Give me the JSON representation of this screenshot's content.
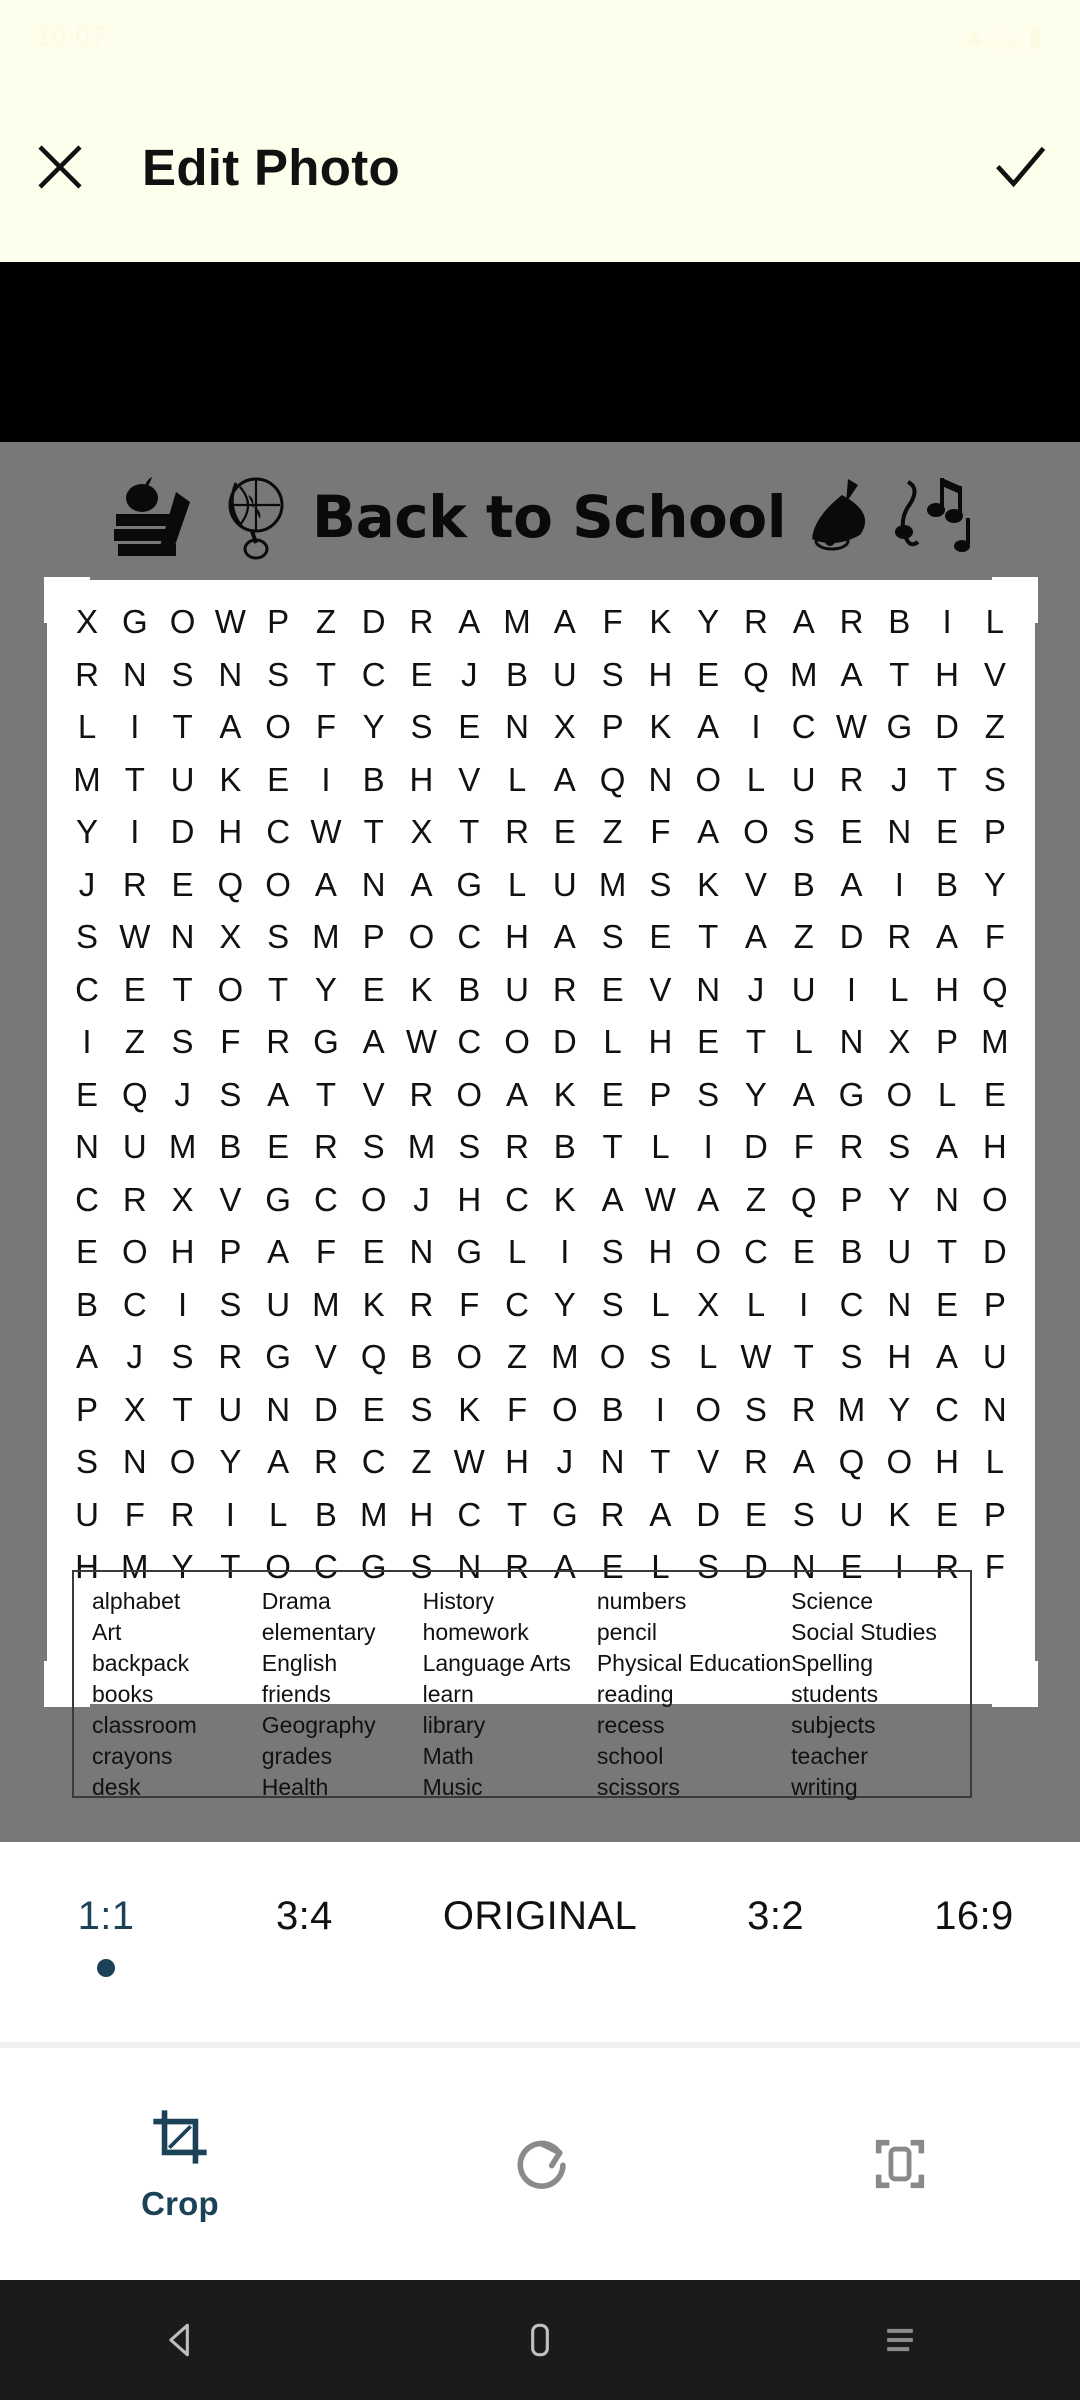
{
  "statusbar": {
    "time": "10:07",
    "icons": [
      "signal-icon",
      "wifi-icon",
      "battery-icon"
    ]
  },
  "header": {
    "title": "Edit Photo",
    "close_icon": "close-icon",
    "confirm_icon": "check-icon"
  },
  "photo": {
    "puzzle_title": "Back to School",
    "clipart": [
      "apple-books-pencil-icon",
      "globe-icon",
      "bell-icon",
      "music-notes-icon"
    ],
    "grid": {
      "rows": 19,
      "cols": 20,
      "letters": [
        [
          "X",
          "G",
          "O",
          "W",
          "P",
          "Z",
          "D",
          "R",
          "A",
          "M",
          "A",
          "F",
          "K",
          "Y",
          "R",
          "A",
          "R",
          "B",
          "I",
          "L"
        ],
        [
          "R",
          "N",
          "S",
          "N",
          "S",
          "T",
          "C",
          "E",
          "J",
          "B",
          "U",
          "S",
          "H",
          "E",
          "Q",
          "M",
          "A",
          "T",
          "H",
          "V"
        ],
        [
          "L",
          "I",
          "T",
          "A",
          "O",
          "F",
          "Y",
          "S",
          "E",
          "N",
          "X",
          "P",
          "K",
          "A",
          "I",
          "C",
          "W",
          "G",
          "D",
          "Z"
        ],
        [
          "M",
          "T",
          "U",
          "K",
          "E",
          "I",
          "B",
          "H",
          "V",
          "L",
          "A",
          "Q",
          "N",
          "O",
          "L",
          "U",
          "R",
          "J",
          "T",
          "S"
        ],
        [
          "Y",
          "I",
          "D",
          "H",
          "C",
          "W",
          "T",
          "X",
          "T",
          "R",
          "E",
          "Z",
          "F",
          "A",
          "O",
          "S",
          "E",
          "N",
          "E",
          "P"
        ],
        [
          "J",
          "R",
          "E",
          "Q",
          "O",
          "A",
          "N",
          "A",
          "G",
          "L",
          "U",
          "M",
          "S",
          "K",
          "V",
          "B",
          "A",
          "I",
          "B",
          "Y"
        ],
        [
          "S",
          "W",
          "N",
          "X",
          "S",
          "M",
          "P",
          "O",
          "C",
          "H",
          "A",
          "S",
          "E",
          "T",
          "A",
          "Z",
          "D",
          "R",
          "A",
          "F"
        ],
        [
          "C",
          "E",
          "T",
          "O",
          "T",
          "Y",
          "E",
          "K",
          "B",
          "U",
          "R",
          "E",
          "V",
          "N",
          "J",
          "U",
          "I",
          "L",
          "H",
          "Q"
        ],
        [
          "I",
          "Z",
          "S",
          "F",
          "R",
          "G",
          "A",
          "W",
          "C",
          "O",
          "D",
          "L",
          "H",
          "E",
          "T",
          "L",
          "N",
          "X",
          "P",
          "M"
        ],
        [
          "E",
          "Q",
          "J",
          "S",
          "A",
          "T",
          "V",
          "R",
          "O",
          "A",
          "K",
          "E",
          "P",
          "S",
          "Y",
          "A",
          "G",
          "O",
          "L",
          "E"
        ],
        [
          "N",
          "U",
          "M",
          "B",
          "E",
          "R",
          "S",
          "M",
          "S",
          "R",
          "B",
          "T",
          "L",
          "I",
          "D",
          "F",
          "R",
          "S",
          "A",
          "H"
        ],
        [
          "C",
          "R",
          "X",
          "V",
          "G",
          "C",
          "O",
          "J",
          "H",
          "C",
          "K",
          "A",
          "W",
          "A",
          "Z",
          "Q",
          "P",
          "Y",
          "N",
          "O"
        ],
        [
          "E",
          "O",
          "H",
          "P",
          "A",
          "F",
          "E",
          "N",
          "G",
          "L",
          "I",
          "S",
          "H",
          "O",
          "C",
          "E",
          "B",
          "U",
          "T",
          "D"
        ],
        [
          "B",
          "C",
          "I",
          "S",
          "U",
          "M",
          "K",
          "R",
          "F",
          "C",
          "Y",
          "S",
          "L",
          "X",
          "L",
          "I",
          "C",
          "N",
          "E",
          "P"
        ],
        [
          "A",
          "J",
          "S",
          "R",
          "G",
          "V",
          "Q",
          "B",
          "O",
          "Z",
          "M",
          "O",
          "S",
          "L",
          "W",
          "T",
          "S",
          "H",
          "A",
          "U"
        ],
        [
          "P",
          "X",
          "T",
          "U",
          "N",
          "D",
          "E",
          "S",
          "K",
          "F",
          "O",
          "B",
          "I",
          "O",
          "S",
          "R",
          "M",
          "Y",
          "C",
          "N"
        ],
        [
          "S",
          "N",
          "O",
          "Y",
          "A",
          "R",
          "C",
          "Z",
          "W",
          "H",
          "J",
          "N",
          "T",
          "V",
          "R",
          "A",
          "Q",
          "O",
          "H",
          "L"
        ],
        [
          "U",
          "F",
          "R",
          "I",
          "L",
          "B",
          "M",
          "H",
          "C",
          "T",
          "G",
          "R",
          "A",
          "D",
          "E",
          "S",
          "U",
          "K",
          "E",
          "P"
        ],
        [
          "H",
          "M",
          "Y",
          "T",
          "O",
          "C",
          "G",
          "S",
          "N",
          "R",
          "A",
          "E",
          "L",
          "S",
          "D",
          "N",
          "E",
          "I",
          "R",
          "F"
        ]
      ]
    },
    "wordlist": {
      "col1": [
        "alphabet",
        "Art",
        "backpack",
        "books",
        "classroom",
        "crayons",
        "desk"
      ],
      "col2": [
        "Drama",
        "elementary",
        "English",
        "friends",
        "Geography",
        "grades",
        "Health"
      ],
      "col3": [
        "History",
        "homework",
        "Language Arts",
        "learn",
        "library",
        "Math",
        "Music"
      ],
      "col4": [
        "numbers",
        "pencil",
        "Physical Education",
        "reading",
        "recess",
        "school",
        "scissors"
      ],
      "col5": [
        "Science",
        "Social Studies",
        "Spelling",
        "students",
        "subjects",
        "teacher",
        "writing"
      ]
    }
  },
  "ratios": {
    "items": [
      {
        "label": "1:1",
        "selected": true
      },
      {
        "label": "3:4",
        "selected": false
      },
      {
        "label": "ORIGINAL",
        "selected": false
      },
      {
        "label": "3:2",
        "selected": false
      },
      {
        "label": "16:9",
        "selected": false
      }
    ],
    "accent_color": "#1B4257"
  },
  "toolbar": {
    "items": [
      {
        "label": "Crop",
        "icon": "crop-icon",
        "active": true
      },
      {
        "label": "",
        "icon": "rotate-icon",
        "active": false
      },
      {
        "label": "",
        "icon": "perspective-icon",
        "active": false
      }
    ]
  },
  "navbar": {
    "back": "back-triangle-icon",
    "home": "home-square-icon",
    "recents": "recents-menu-icon"
  }
}
